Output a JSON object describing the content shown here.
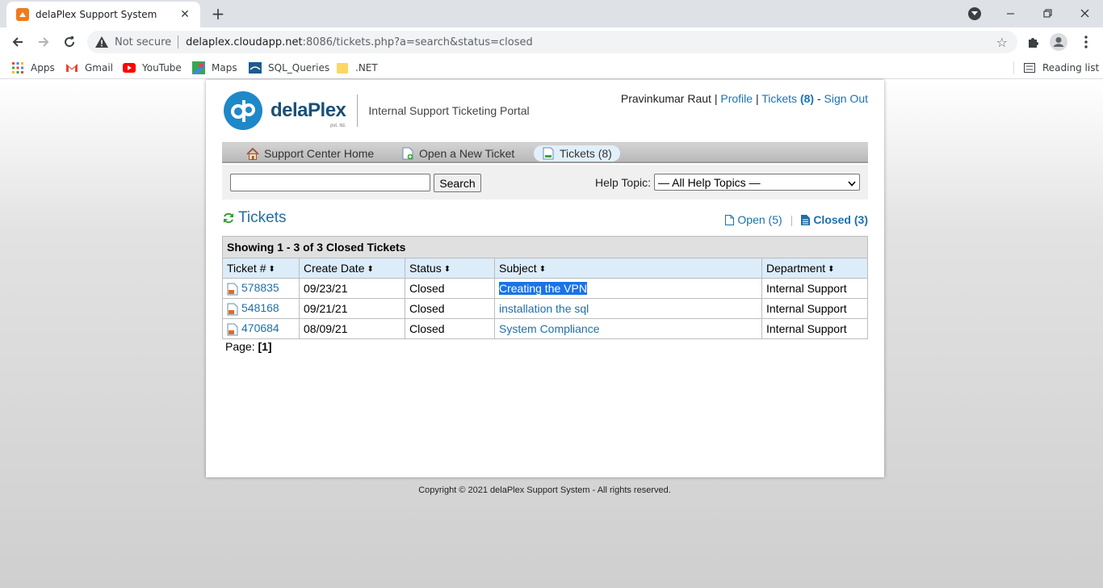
{
  "browser": {
    "tab_title": "delaPlex Support System",
    "tab_close": "✕",
    "new_tab": "+",
    "security_label": "Not secure",
    "url_host": "delaplex.cloudapp.net",
    "url_path": ":8086/tickets.php?a=search&status=closed",
    "bookmarks": [
      "Apps",
      "Gmail",
      "YouTube",
      "Maps",
      "SQL_Queries",
      ".NET"
    ],
    "reading_list": "Reading list"
  },
  "header": {
    "logo_text": "delaPlex",
    "logo_sub": "pvt. ltd.",
    "portal_title": "Internal Support Ticketing Portal",
    "user_name": "Pravinkumar Raut",
    "sep1": "|",
    "profile_link": "Profile",
    "sep2": "|",
    "tickets_link": "Tickets",
    "tickets_count": "(8)",
    "sep3": "-",
    "signout_link": "Sign Out"
  },
  "nav": {
    "home": "Support Center Home",
    "new_ticket": "Open a New Ticket",
    "tickets": "Tickets (8)"
  },
  "search": {
    "input_value": "",
    "button": "Search",
    "help_topic_label": "Help Topic:",
    "help_topic_selected": "— All Help Topics —"
  },
  "tickets": {
    "heading": "Tickets",
    "open_filter": "Open (5)",
    "filter_sep": "|",
    "closed_filter": "Closed (3)",
    "caption": "Showing 1 - 3 of 3 Closed Tickets",
    "columns": [
      "Ticket #",
      "Create Date",
      "Status",
      "Subject",
      "Department"
    ],
    "rows": [
      {
        "number": "578835",
        "date": "09/23/21",
        "status": "Closed",
        "subject": "Creating the VPN",
        "department": "Internal Support"
      },
      {
        "number": "548168",
        "date": "09/21/21",
        "status": "Closed",
        "subject": "installation the sql",
        "department": "Internal Support"
      },
      {
        "number": "470684",
        "date": "08/09/21",
        "status": "Closed",
        "subject": "System Compliance",
        "department": "Internal Support"
      }
    ],
    "page_label": "Page:",
    "page_current": "[1]"
  },
  "footer": {
    "copyright": "Copyright © 2021 delaPlex Support System - All rights reserved."
  },
  "colors": {
    "link": "#1f6fa8",
    "brand": "#1e88c9",
    "selection": "#1a73e8"
  }
}
